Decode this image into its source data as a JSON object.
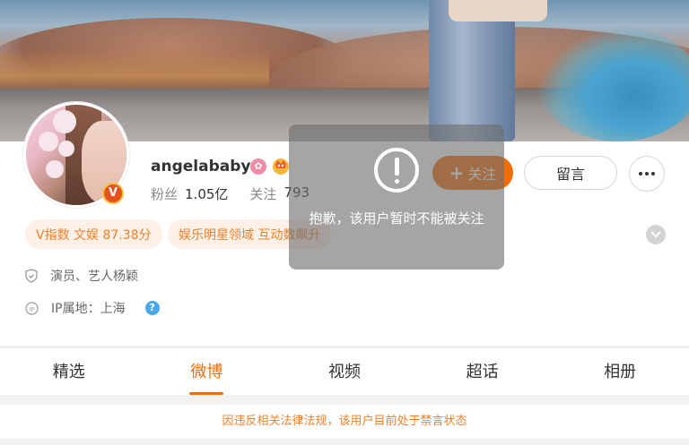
{
  "profile": {
    "username": "angelababy",
    "verified_badge": "V",
    "badge_icon_pink": "pink-circle-icon",
    "badge_icon_crown": "crown-icon",
    "followers_label": "粉丝",
    "followers_value": "1.05亿",
    "following_label": "关注",
    "following_value": "793"
  },
  "actions": {
    "follow_icon": "+",
    "follow_label": "关注",
    "message_label": "留言",
    "more_icon": "more-icon"
  },
  "tags": [
    {
      "text": "V指数 文娱 87.38分"
    },
    {
      "text": "娱乐明星领域 互动数飙升"
    }
  ],
  "info": {
    "role": "演员、艺人杨颖",
    "ip_label": "IP属地：上海",
    "help_icon": "?"
  },
  "tabs": [
    {
      "label": "精选",
      "active": false
    },
    {
      "label": "微博",
      "active": true
    },
    {
      "label": "视频",
      "active": false
    },
    {
      "label": "超话",
      "active": false
    },
    {
      "label": "相册",
      "active": false
    }
  ],
  "notice": "因违反相关法律法规，该用户目前处于禁言状态",
  "toast": {
    "icon": "warning-icon",
    "message": "抱歉，该用户暂时不能被关注"
  },
  "colors": {
    "accent": "#f26d06",
    "tag_text": "#e8822d",
    "tag_bg": "#fdf0e7"
  }
}
